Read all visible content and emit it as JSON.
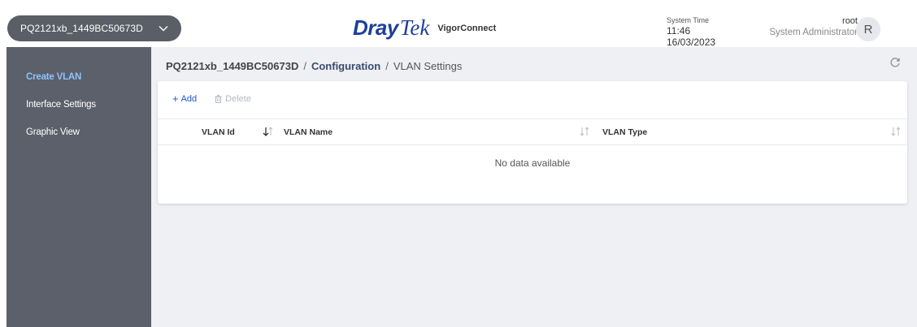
{
  "header": {
    "device": "PQ2121xb_1449BC50673D",
    "logo_brand_1": "Dray",
    "logo_brand_2": "Tek",
    "logo_product": "VigorConnect",
    "system_time_label": "System Time",
    "system_time_value": "11:46 16/03/2023",
    "user_name": "root",
    "user_role": "System Administrator",
    "avatar_letter": "R"
  },
  "sidebar": {
    "items": [
      {
        "label": "Create VLAN",
        "active": true
      },
      {
        "label": "Interface Settings",
        "active": false
      },
      {
        "label": "Graphic View",
        "active": false
      }
    ]
  },
  "breadcrumb": {
    "device": "PQ2121xb_1449BC50673D",
    "separator": "/",
    "section": "Configuration",
    "page": "VLAN Settings"
  },
  "toolbar": {
    "add_label": "Add",
    "delete_label": "Delete"
  },
  "table": {
    "columns": [
      "VLAN Id",
      "VLAN Name",
      "VLAN Type"
    ],
    "empty_text": "No data available"
  },
  "colors": {
    "brand_blue": "#1d3f9a",
    "sidebar_bg": "#5b606a",
    "active_link": "#8cc4ff",
    "add_blue": "#2156c9"
  }
}
